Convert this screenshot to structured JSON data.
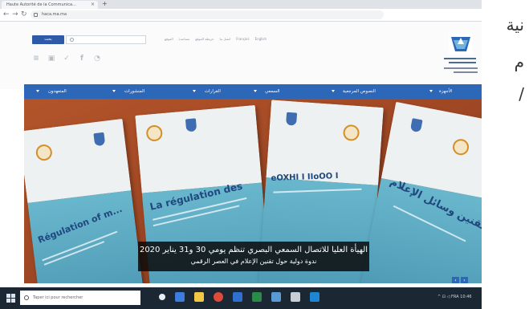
{
  "browser": {
    "tab_title": "Haute Autorité de la Communica...",
    "url": "haca.ma.ma",
    "new_tab_symbol": "+",
    "close_symbol": "×"
  },
  "header": {
    "search_button": "بحث",
    "search_placeholder": "",
    "top_links": [
      "الموقع",
      "مساعدة",
      "خريطة الموقع",
      "اتصل بنا",
      "Français",
      "English"
    ],
    "social_icons": [
      "mail-icon",
      "youtube-icon",
      "twitter-icon",
      "facebook-icon",
      "rss-icon"
    ]
  },
  "nav": {
    "items": [
      "الأجهزة",
      "النصوص المرجعية",
      "السمعي",
      "القرارات",
      "المنشورات",
      "المتعهدون"
    ]
  },
  "hero": {
    "brochure_titles": [
      "Régulation of m...",
      "La régulation des",
      "eOXHI I IIoOO I",
      "تقنين وسائل الإعلام"
    ],
    "caption_line1": "الهيأة العليا للاتصال السمعي البصري تنظم يومي 30 و31 يناير 2020",
    "caption_line2": "ندوة دولية حول تقنين الإعلام في العصر الرقمي",
    "prev_arrow": "‹",
    "next_arrow": "›"
  },
  "taskbar": {
    "search_text": "Taper ici pour rechercher",
    "tray_text": "^ ⊡ ◁ FRA  10:46"
  },
  "side_text": [
    "نية",
    "م",
    "/"
  ],
  "colors": {
    "nav_blue": "#2d67b8",
    "hero_brown": "#a04824",
    "brochure_blue": "#5aa8c1"
  }
}
